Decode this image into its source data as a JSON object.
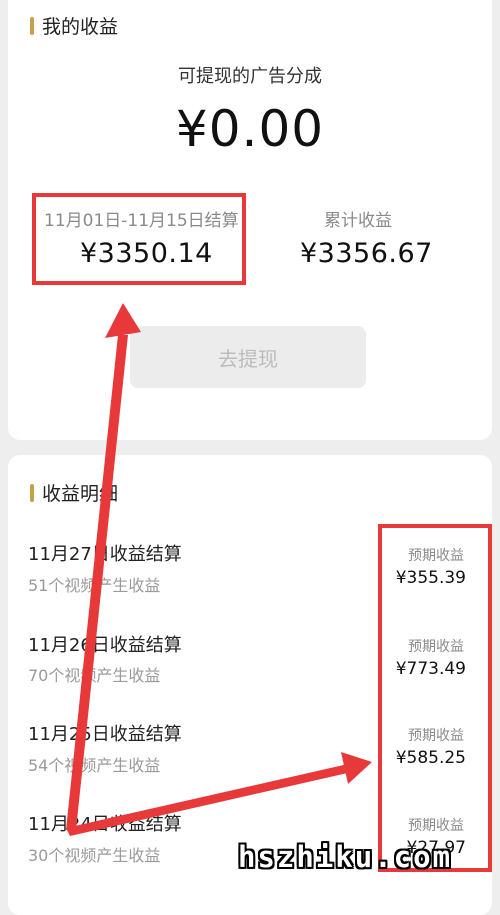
{
  "earnings_card": {
    "section_title": "我的收益",
    "withdrawable_label": "可提现的广告分成",
    "withdrawable_amount": "¥0.00",
    "period_label": "11月01日-11月15日结算",
    "period_amount": "¥3350.14",
    "total_label": "累计收益",
    "total_amount": "¥3356.67",
    "withdraw_button": "去提现"
  },
  "details": {
    "section_title": "收益明细",
    "rows": [
      {
        "title": "11月27日收益结算",
        "subtitle": "51个视频产生收益",
        "amount_label": "预期收益",
        "amount": "¥355.39"
      },
      {
        "title": "11月26日收益结算",
        "subtitle": "70个视频产生收益",
        "amount_label": "预期收益",
        "amount": "¥773.49"
      },
      {
        "title": "11月25日收益结算",
        "subtitle": "54个视频产生收益",
        "amount_label": "预期收益",
        "amount": "¥585.25"
      },
      {
        "title": "11月24日收益结算",
        "subtitle": "30个视频产生收益",
        "amount_label": "预期收益",
        "amount": "¥27.97"
      }
    ]
  },
  "watermark": "hszhiku.com",
  "colors": {
    "accent_bar": "#c9a04a",
    "annotation_red": "#e8393a",
    "button_bg": "#ececec"
  }
}
